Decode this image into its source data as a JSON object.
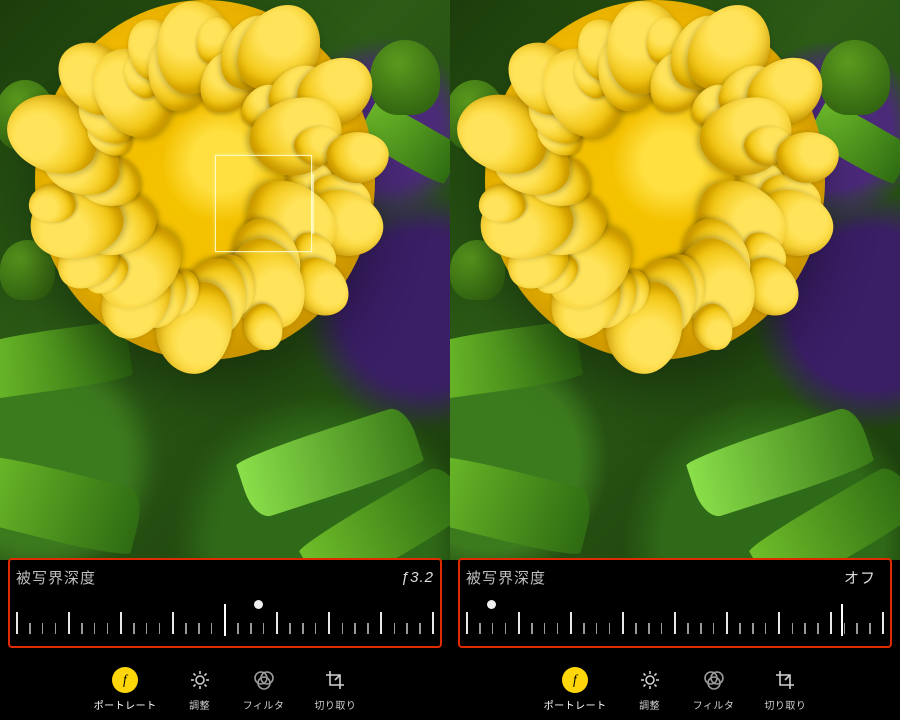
{
  "panels": [
    {
      "dof_label": "被写界深度",
      "dof_value": "ƒ3.2",
      "slider_position_percent": 58,
      "indicator_percent": 50
    },
    {
      "dof_label": "被写界深度",
      "dof_value": "オフ",
      "slider_position_percent": 6,
      "indicator_percent": 90
    }
  ],
  "tabs": [
    {
      "id": "portrait",
      "label": "ポートレート",
      "active": true
    },
    {
      "id": "adjust",
      "label": "調整",
      "active": false
    },
    {
      "id": "filter",
      "label": "フィルタ",
      "active": false
    },
    {
      "id": "crop",
      "label": "切り取り",
      "active": false
    }
  ],
  "slider_tick_count": 33,
  "slider_major_every": 4
}
